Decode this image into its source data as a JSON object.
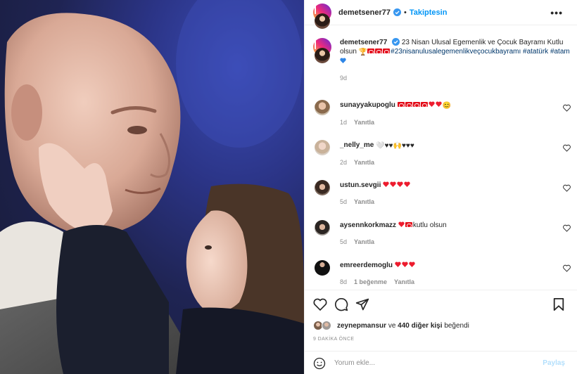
{
  "header": {
    "username": "demetsener77",
    "separator": "•",
    "follow_label": "Takiptesin",
    "more_icon": "more-dots-icon"
  },
  "caption": {
    "username": "demetsener77",
    "text_before": "23 Nisan Ulusal Egemenlik ve Çocuk Bayramı Kutlu olsun",
    "hashtags": "#23nisanulusalegemenlikveçocukbayramı #atatürk #atam",
    "time": "9d"
  },
  "comments": [
    {
      "username": "sunayyakupoglu",
      "text": "",
      "time": "1d",
      "likes": "",
      "reply": "Yanıtla"
    },
    {
      "username": "_nelly_me",
      "text": "",
      "time": "2d",
      "likes": "",
      "reply": "Yanıtla"
    },
    {
      "username": "ustun.sevgii",
      "text": "",
      "time": "5d",
      "likes": "",
      "reply": "Yanıtla"
    },
    {
      "username": "aysennkorkmazz",
      "text": "kutlu olsun",
      "time": "5d",
      "likes": "",
      "reply": "Yanıtla"
    },
    {
      "username": "emreerdemoglu",
      "text": "",
      "time": "8d",
      "likes": "1 beğenme",
      "reply": "Yanıtla"
    }
  ],
  "likes_line": {
    "user": "zeynepmansur",
    "middle": "ve",
    "others": "440 diğer kişi",
    "suffix": "beğendi"
  },
  "timestamp": "9 DAKİKA ÖNCE",
  "comment_box": {
    "placeholder": "Yorum ekle...",
    "post_label": "Paylaş"
  },
  "colors": {
    "accent": "#0095f6",
    "hashtag": "#00376b",
    "muted": "#8e8e8e",
    "heart_red": "#ed4956",
    "post_disabled": "#b2dffc"
  }
}
